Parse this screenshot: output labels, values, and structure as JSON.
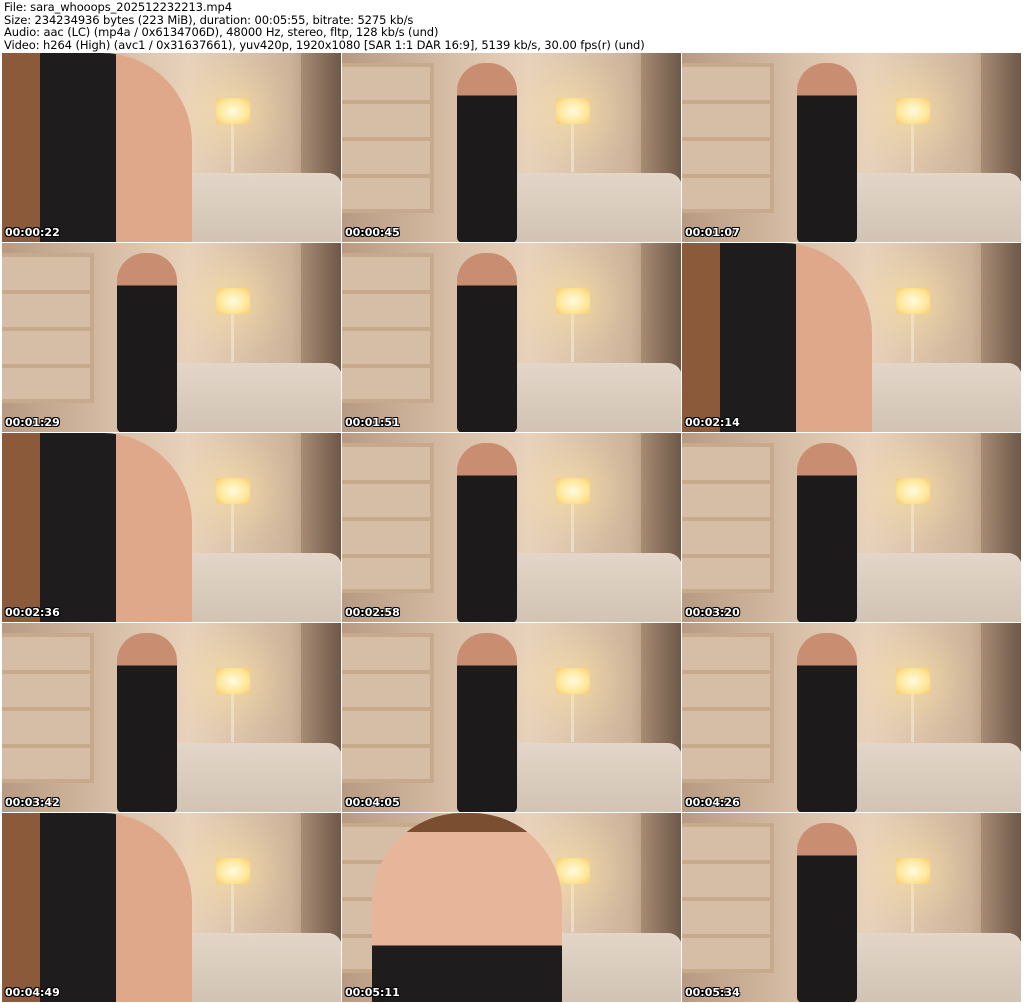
{
  "header": {
    "file": "File: sara_whooops_202512232213.mp4",
    "size": "Size: 234234936 bytes (223 MiB), duration: 00:05:55, bitrate: 5275 kb/s",
    "audio": "Audio: aac (LC) (mp4a / 0x6134706D), 48000 Hz, stereo, fltp, 128 kb/s (und)",
    "video": "Video: h264 (High) (avc1 / 0x31637661), yuv420p, 1920x1080 [SAR 1:1 DAR 16:9], 5139 kb/s, 30.00 fps(r) (und)"
  },
  "thumbnails": [
    {
      "time": "00:00:22",
      "shot": "close"
    },
    {
      "time": "00:00:45",
      "shot": "full"
    },
    {
      "time": "00:01:07",
      "shot": "full"
    },
    {
      "time": "00:01:29",
      "shot": "full"
    },
    {
      "time": "00:01:51",
      "shot": "full"
    },
    {
      "time": "00:02:14",
      "shot": "close"
    },
    {
      "time": "00:02:36",
      "shot": "close"
    },
    {
      "time": "00:02:58",
      "shot": "full"
    },
    {
      "time": "00:03:20",
      "shot": "full"
    },
    {
      "time": "00:03:42",
      "shot": "full"
    },
    {
      "time": "00:04:05",
      "shot": "full"
    },
    {
      "time": "00:04:26",
      "shot": "full"
    },
    {
      "time": "00:04:49",
      "shot": "close"
    },
    {
      "time": "00:05:11",
      "shot": "face"
    },
    {
      "time": "00:05:34",
      "shot": "full"
    }
  ]
}
